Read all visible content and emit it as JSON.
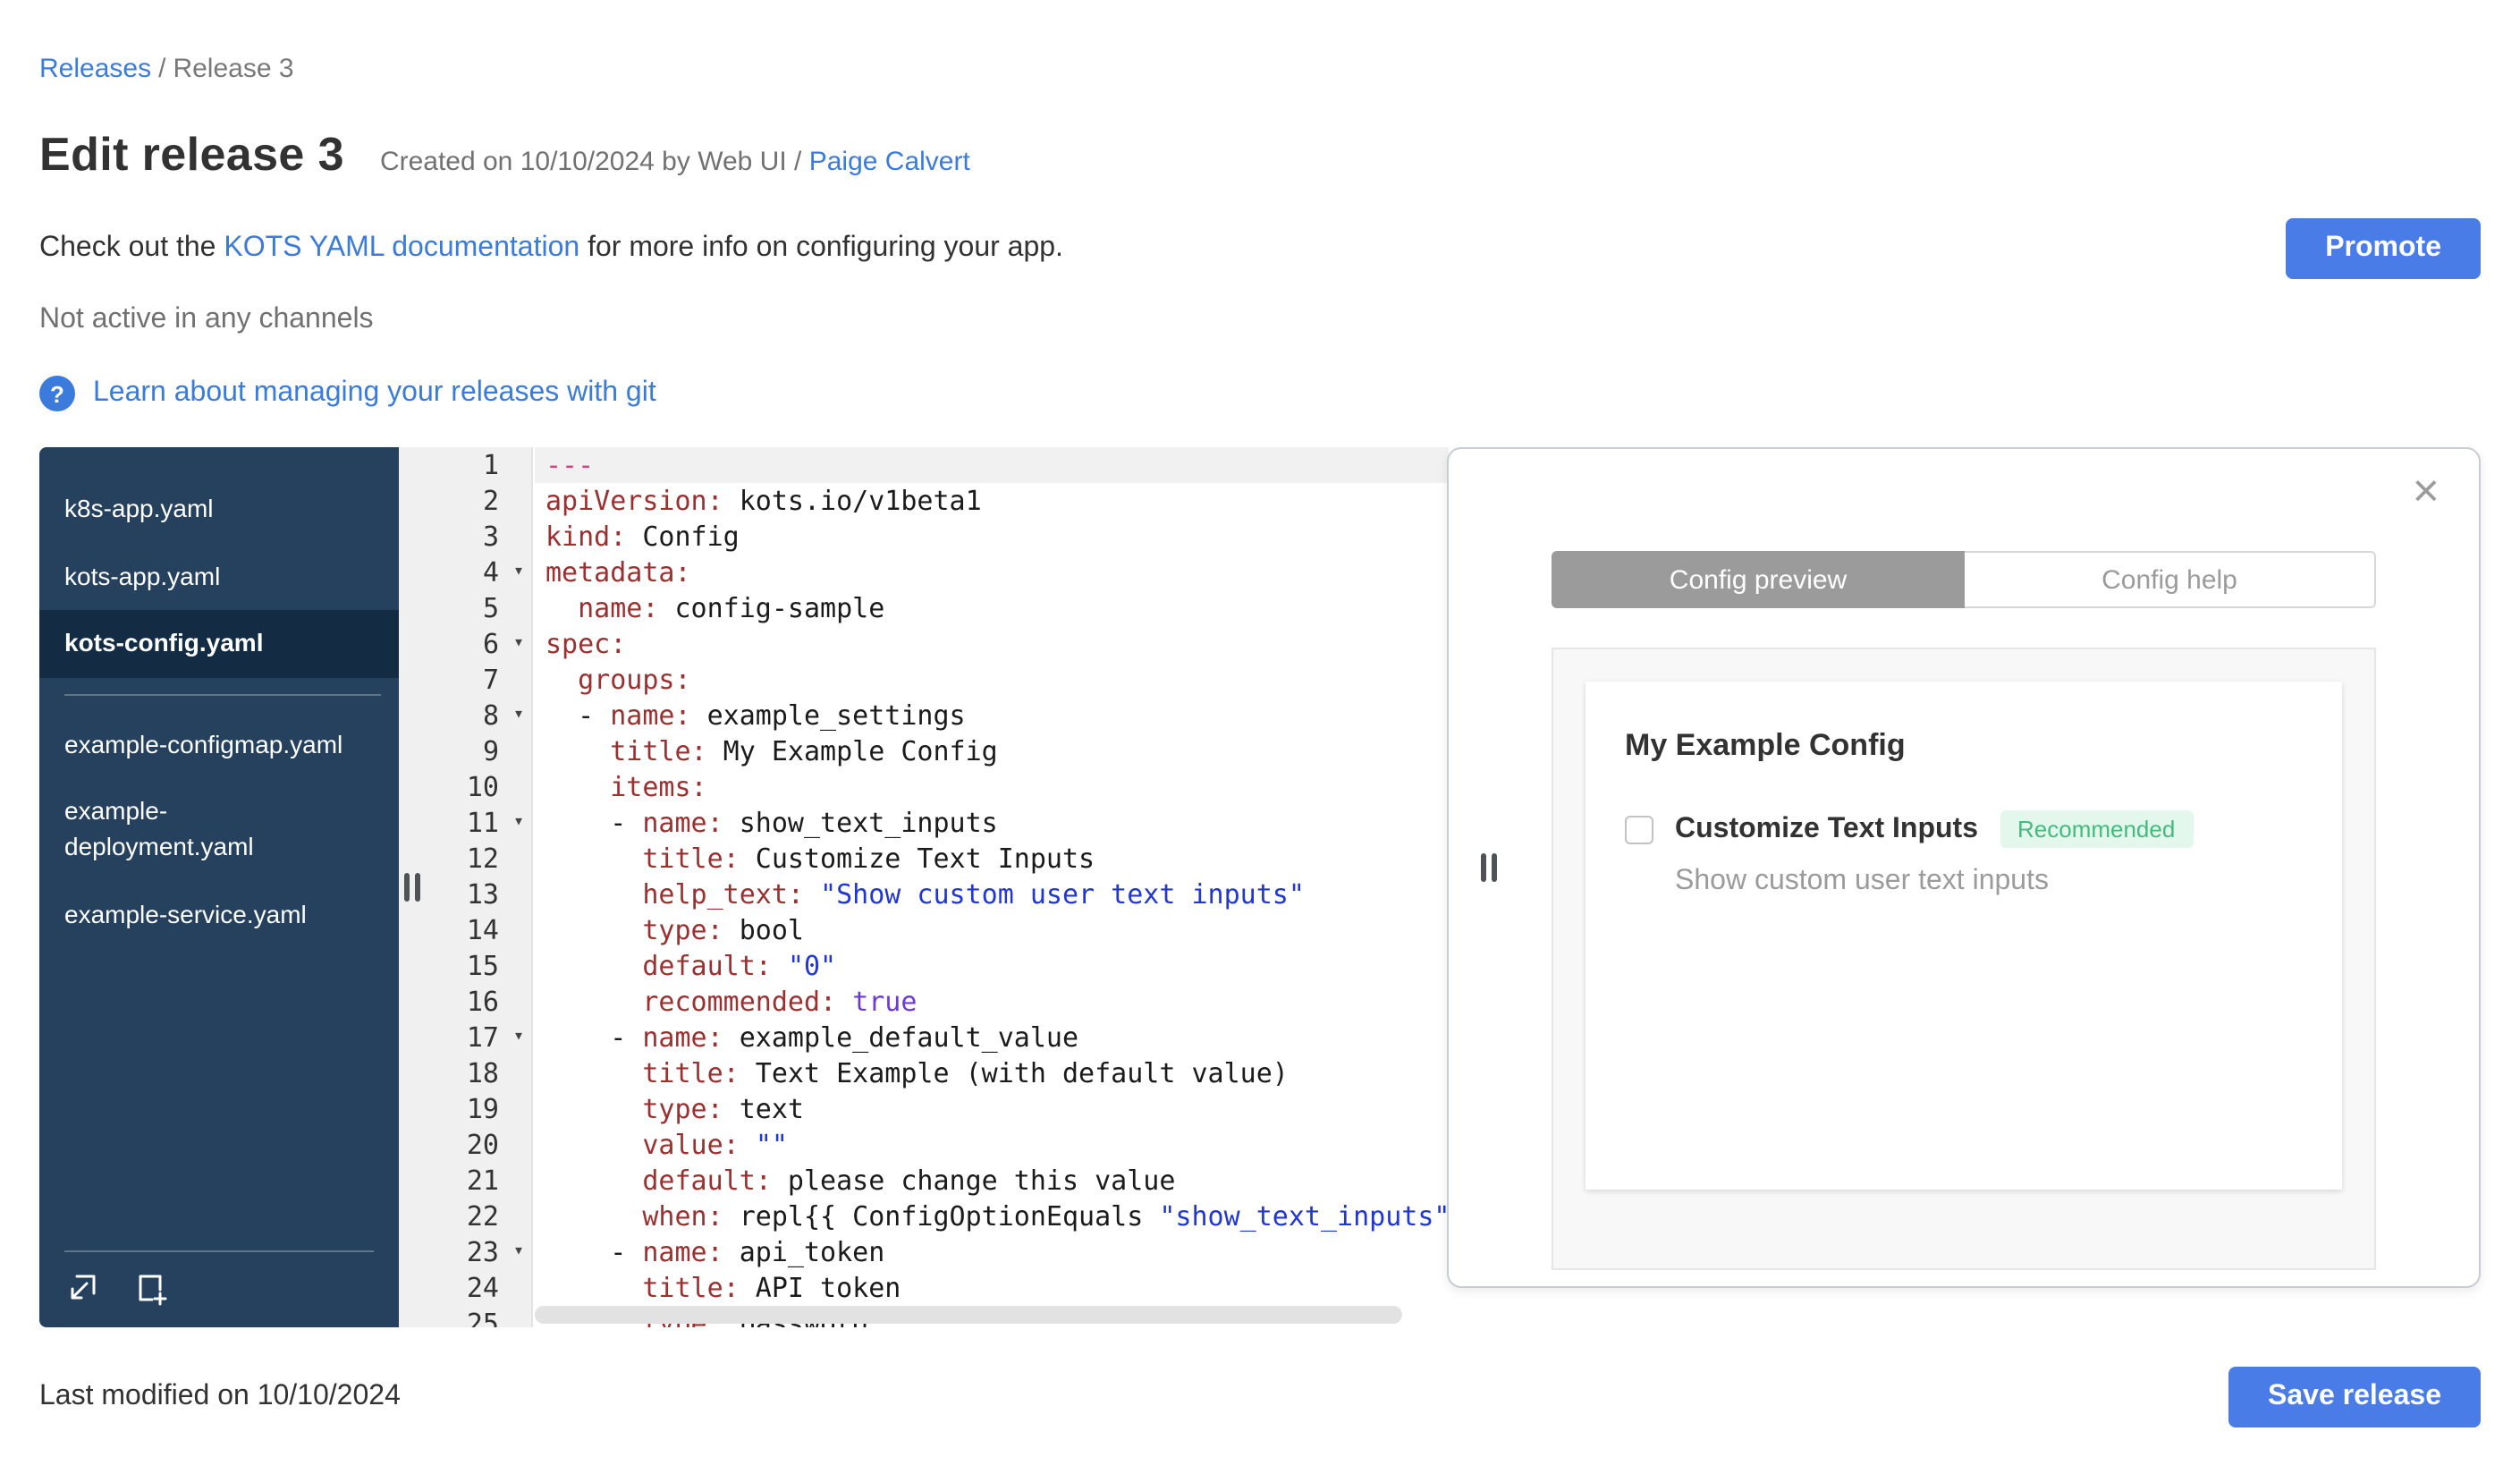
{
  "breadcrumb": {
    "link": "Releases",
    "separator": "/",
    "current": "Release 3"
  },
  "header": {
    "title": "Edit release 3",
    "created_prefix": "Created on 10/10/2024 by Web UI / ",
    "created_author": "Paige Calvert",
    "docs_prefix": "Check out the ",
    "docs_link": "KOTS YAML documentation",
    "docs_suffix": " for more info on configuring your app.",
    "channel_status": "Not active in any channels",
    "git_link": "Learn about managing your releases with git",
    "promote_label": "Promote"
  },
  "icons": {
    "help": "?",
    "close": "×",
    "fold": "▾"
  },
  "file_tree": {
    "groups": [
      {
        "files": [
          {
            "name": "k8s-app.yaml",
            "selected": false
          },
          {
            "name": "kots-app.yaml",
            "selected": false
          },
          {
            "name": "kots-config.yaml",
            "selected": true
          }
        ]
      },
      {
        "files": [
          {
            "name": "example-configmap.yaml",
            "selected": false
          },
          {
            "name": "example-deployment.yaml",
            "selected": false
          },
          {
            "name": "example-service.yaml",
            "selected": false
          }
        ]
      }
    ]
  },
  "editor": {
    "lines": [
      {
        "n": 1,
        "active": true,
        "tokens": [
          [
            "doc",
            "---"
          ]
        ]
      },
      {
        "n": 2,
        "tokens": [
          [
            "key",
            "apiVersion:"
          ],
          [
            "plain",
            " kots.io/v1beta1"
          ]
        ]
      },
      {
        "n": 3,
        "tokens": [
          [
            "key",
            "kind:"
          ],
          [
            "plain",
            " Config"
          ]
        ]
      },
      {
        "n": 4,
        "fold": true,
        "tokens": [
          [
            "key",
            "metadata:"
          ]
        ]
      },
      {
        "n": 5,
        "tokens": [
          [
            "plain",
            "  "
          ],
          [
            "key",
            "name:"
          ],
          [
            "plain",
            " config-sample"
          ]
        ]
      },
      {
        "n": 6,
        "fold": true,
        "tokens": [
          [
            "key",
            "spec:"
          ]
        ]
      },
      {
        "n": 7,
        "tokens": [
          [
            "plain",
            "  "
          ],
          [
            "key",
            "groups:"
          ]
        ]
      },
      {
        "n": 8,
        "fold": true,
        "tokens": [
          [
            "plain",
            "  - "
          ],
          [
            "key",
            "name:"
          ],
          [
            "plain",
            " example_settings"
          ]
        ]
      },
      {
        "n": 9,
        "tokens": [
          [
            "plain",
            "    "
          ],
          [
            "key",
            "title:"
          ],
          [
            "plain",
            " My Example Config"
          ]
        ]
      },
      {
        "n": 10,
        "tokens": [
          [
            "plain",
            "    "
          ],
          [
            "key",
            "items:"
          ]
        ]
      },
      {
        "n": 11,
        "fold": true,
        "tokens": [
          [
            "plain",
            "    - "
          ],
          [
            "key",
            "name:"
          ],
          [
            "plain",
            " show_text_inputs"
          ]
        ]
      },
      {
        "n": 12,
        "tokens": [
          [
            "plain",
            "      "
          ],
          [
            "key",
            "title:"
          ],
          [
            "plain",
            " Customize Text Inputs"
          ]
        ]
      },
      {
        "n": 13,
        "tokens": [
          [
            "plain",
            "      "
          ],
          [
            "key",
            "help_text:"
          ],
          [
            "plain",
            " "
          ],
          [
            "str",
            "\"Show custom user text inputs\""
          ]
        ]
      },
      {
        "n": 14,
        "tokens": [
          [
            "plain",
            "      "
          ],
          [
            "key",
            "type:"
          ],
          [
            "plain",
            " bool"
          ]
        ]
      },
      {
        "n": 15,
        "tokens": [
          [
            "plain",
            "      "
          ],
          [
            "key",
            "default:"
          ],
          [
            "plain",
            " "
          ],
          [
            "str",
            "\"0\""
          ]
        ]
      },
      {
        "n": 16,
        "tokens": [
          [
            "plain",
            "      "
          ],
          [
            "key",
            "recommended:"
          ],
          [
            "plain",
            " "
          ],
          [
            "bool",
            "true"
          ]
        ]
      },
      {
        "n": 17,
        "fold": true,
        "tokens": [
          [
            "plain",
            "    - "
          ],
          [
            "key",
            "name:"
          ],
          [
            "plain",
            " example_default_value"
          ]
        ]
      },
      {
        "n": 18,
        "tokens": [
          [
            "plain",
            "      "
          ],
          [
            "key",
            "title:"
          ],
          [
            "plain",
            " Text Example (with default value)"
          ]
        ]
      },
      {
        "n": 19,
        "tokens": [
          [
            "plain",
            "      "
          ],
          [
            "key",
            "type:"
          ],
          [
            "plain",
            " text"
          ]
        ]
      },
      {
        "n": 20,
        "tokens": [
          [
            "plain",
            "      "
          ],
          [
            "key",
            "value:"
          ],
          [
            "plain",
            " "
          ],
          [
            "str",
            "\"\""
          ]
        ]
      },
      {
        "n": 21,
        "tokens": [
          [
            "plain",
            "      "
          ],
          [
            "key",
            "default:"
          ],
          [
            "plain",
            " please change this value"
          ]
        ]
      },
      {
        "n": 22,
        "tokens": [
          [
            "plain",
            "      "
          ],
          [
            "key",
            "when:"
          ],
          [
            "plain",
            " repl{{ ConfigOptionEquals "
          ],
          [
            "str",
            "\"show_text_inputs\""
          ]
        ]
      },
      {
        "n": 23,
        "fold": true,
        "tokens": [
          [
            "plain",
            "    - "
          ],
          [
            "key",
            "name:"
          ],
          [
            "plain",
            " api_token"
          ]
        ]
      },
      {
        "n": 24,
        "tokens": [
          [
            "plain",
            "      "
          ],
          [
            "key",
            "title:"
          ],
          [
            "plain",
            " API token"
          ]
        ]
      },
      {
        "n": 25,
        "tokens": [
          [
            "plain",
            "      "
          ],
          [
            "key",
            "type:"
          ],
          [
            "plain",
            " password"
          ]
        ]
      }
    ]
  },
  "preview": {
    "tabs": [
      {
        "label": "Config preview",
        "active": true
      },
      {
        "label": "Config help",
        "active": false
      }
    ],
    "config": {
      "group_title": "My Example Config",
      "item_title": "Customize Text Inputs",
      "badge": "Recommended",
      "help_text": "Show custom user text inputs",
      "checked": false
    }
  },
  "footer": {
    "last_modified": "Last modified on 10/10/2024",
    "save_label": "Save release"
  },
  "colors": {
    "link": "#3b7bdc",
    "button": "#4a7ce8",
    "sidebar_bg": "#25415e",
    "sidebar_selected_bg": "#132c44",
    "badge_bg": "#e3f7ec",
    "badge_text": "#44bb7e",
    "tab_active_bg": "#9b9b9b",
    "code_key": "#9c3031",
    "code_string": "#2136d4",
    "code_bool": "#6d3bd4",
    "code_doc": "#d8437c"
  }
}
